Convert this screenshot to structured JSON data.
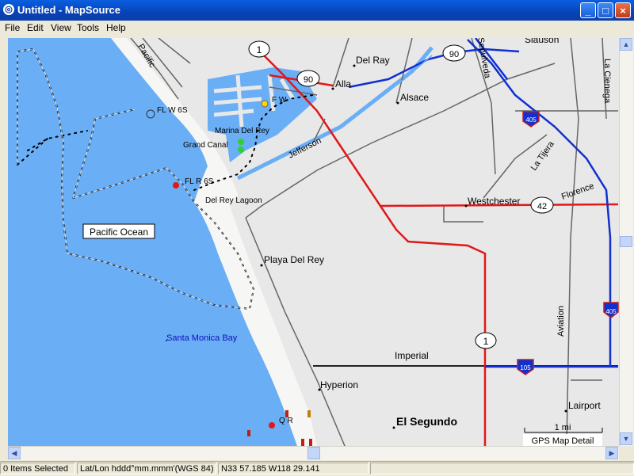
{
  "window": {
    "title": "Untitled - MapSource",
    "app_icon": "mapsource-app-icon",
    "minimize": "_",
    "maximize": "□",
    "close": "×"
  },
  "menu": [
    "File",
    "Edit",
    "View",
    "Tools",
    "Help"
  ],
  "map": {
    "water_labels": {
      "ocean": "Pacific Ocean",
      "bay": "Santa Monica Bay"
    },
    "places": {
      "del_rey": "Del Ray",
      "alla": "Alla",
      "alsace": "Alsace",
      "marina": "Marina Del Rey",
      "grand_canal": "Grand Canal",
      "lagoon": "Del Rey Lagoon",
      "playa": "Playa Del Rey",
      "westchester": "Westchester",
      "hyperion": "Hyperion",
      "el_segundo": "El Segundo",
      "lairport": "Lairport",
      "slauson": "Slauson",
      "fl_w6s": "FL W 6S",
      "fw": "F W",
      "flr": "FL R 6S",
      "qr": "Q R"
    },
    "roads": {
      "pacific": "Pacific",
      "jefferson": "Jefferson",
      "la_tijera": "La Tijera",
      "florence": "Florence",
      "aviation": "Aviation",
      "imperial": "Imperial",
      "la_cienega": "La Cienega",
      "sepulveda": "Sepulveda"
    },
    "shields": {
      "r1a": "1",
      "r90a": "90",
      "r90b": "90",
      "r42": "42",
      "r1b": "1",
      "i405a": "405",
      "i405b": "405",
      "i105": "105"
    },
    "scale": "1 mi",
    "attribution": "GPS Map Detail",
    "colors": {
      "water": "#6aaef5",
      "land": "#e8e8e8",
      "beach": "#f4f4f2",
      "highway_red": "#e01818",
      "highway_blue": "#1030d0",
      "track": "#000000"
    }
  },
  "status": {
    "selection": "0 Items Selected",
    "format": "Lat/Lon hddd°mm.mmm'(WGS 84)",
    "position": "N33 57.185 W118 29.141"
  }
}
